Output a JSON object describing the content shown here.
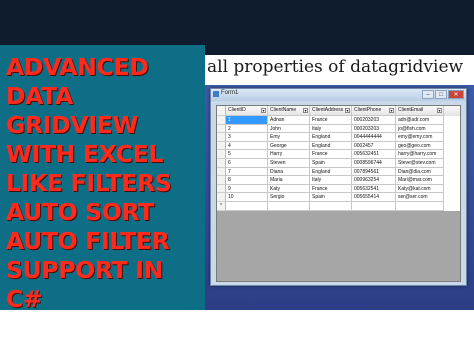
{
  "title_lines": [
    "ADVANCED",
    "DATA",
    "GRIDVIEW",
    "WITH EXCEL",
    "LIKE FILTERS",
    "AUTO SORT",
    "AUTO FILTER",
    "SUPPORT IN",
    "C#"
  ],
  "caption": "all properties of datagridview",
  "window": {
    "title": "Form1",
    "minimize": "–",
    "maximize": "□",
    "close": "✕"
  },
  "grid": {
    "columns": [
      "ClientID",
      "ClientName",
      "ClientAddress",
      "ClientPhone",
      "ClientEmail"
    ],
    "rows": [
      [
        "1",
        "Adnan",
        "France",
        "000203203",
        "adn@adr.com"
      ],
      [
        "2",
        "John",
        "Italy",
        "000203203",
        "jo@fish.com"
      ],
      [
        "3",
        "Emy",
        "England",
        "0044444444",
        "emy@emy.com"
      ],
      [
        "4",
        "George",
        "England",
        "0002457",
        "geo@geo.com"
      ],
      [
        "5",
        "Harry",
        "France",
        "005632451",
        "harry@harry.com"
      ],
      [
        "6",
        "Steven",
        "Spain",
        "0008596744",
        "Steve@stev.com"
      ],
      [
        "7",
        "Diana",
        "England",
        "007894561",
        "Dian@dia.com"
      ],
      [
        "8",
        "Maria",
        "Italy",
        "000963254",
        "Mari@mar.com"
      ],
      [
        "9",
        "Katy",
        "France",
        "005632541",
        "Katy@kat.com"
      ],
      [
        "10",
        "Sergio",
        "Spain",
        "005655414",
        "ser@ser.com"
      ]
    ],
    "new_row_marker": "*"
  },
  "colors": {
    "title_text": "#ff2a1c",
    "left_panel": "#0e6e86",
    "background": "#0f1c2e",
    "selection": "#3399ff"
  }
}
